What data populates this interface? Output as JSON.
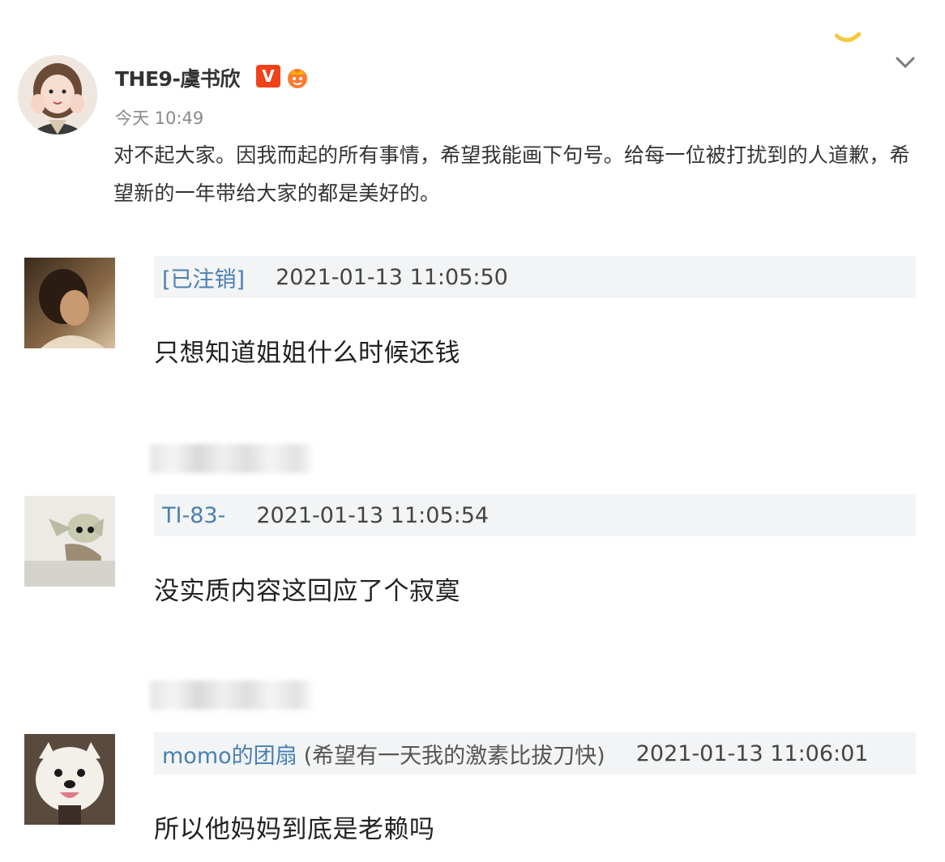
{
  "post": {
    "author": "THE9-虞书欣",
    "verified_badge": "V",
    "time": "今天 10:49",
    "text": "对不起大家。因我而起的所有事情，希望我能画下句号。给每一位被打扰到的人道歉，希望新的一年带给大家的都是美好的。"
  },
  "comments": [
    {
      "user": "[已注销]",
      "note": "",
      "time": "2021-01-13 11:05:50",
      "text": "只想知道姐姐什么时候还钱",
      "avatar_icon": "silhouette-portrait"
    },
    {
      "user": "TI-83-",
      "note": "",
      "time": "2021-01-13 11:05:54",
      "text": "没实质内容这回应了个寂寞",
      "avatar_icon": "baby-yoda-figure"
    },
    {
      "user": "momo的团扇",
      "note": "(希望有一天我的激素比拔刀快)",
      "time": "2021-01-13 11:06:01",
      "text": "所以他妈妈到底是老赖吗",
      "avatar_icon": "samoyed-dog"
    }
  ],
  "colors": {
    "username": "#4a7fb0",
    "badge": "#f0431b",
    "comment_header_bg": "#f2f4f5"
  }
}
